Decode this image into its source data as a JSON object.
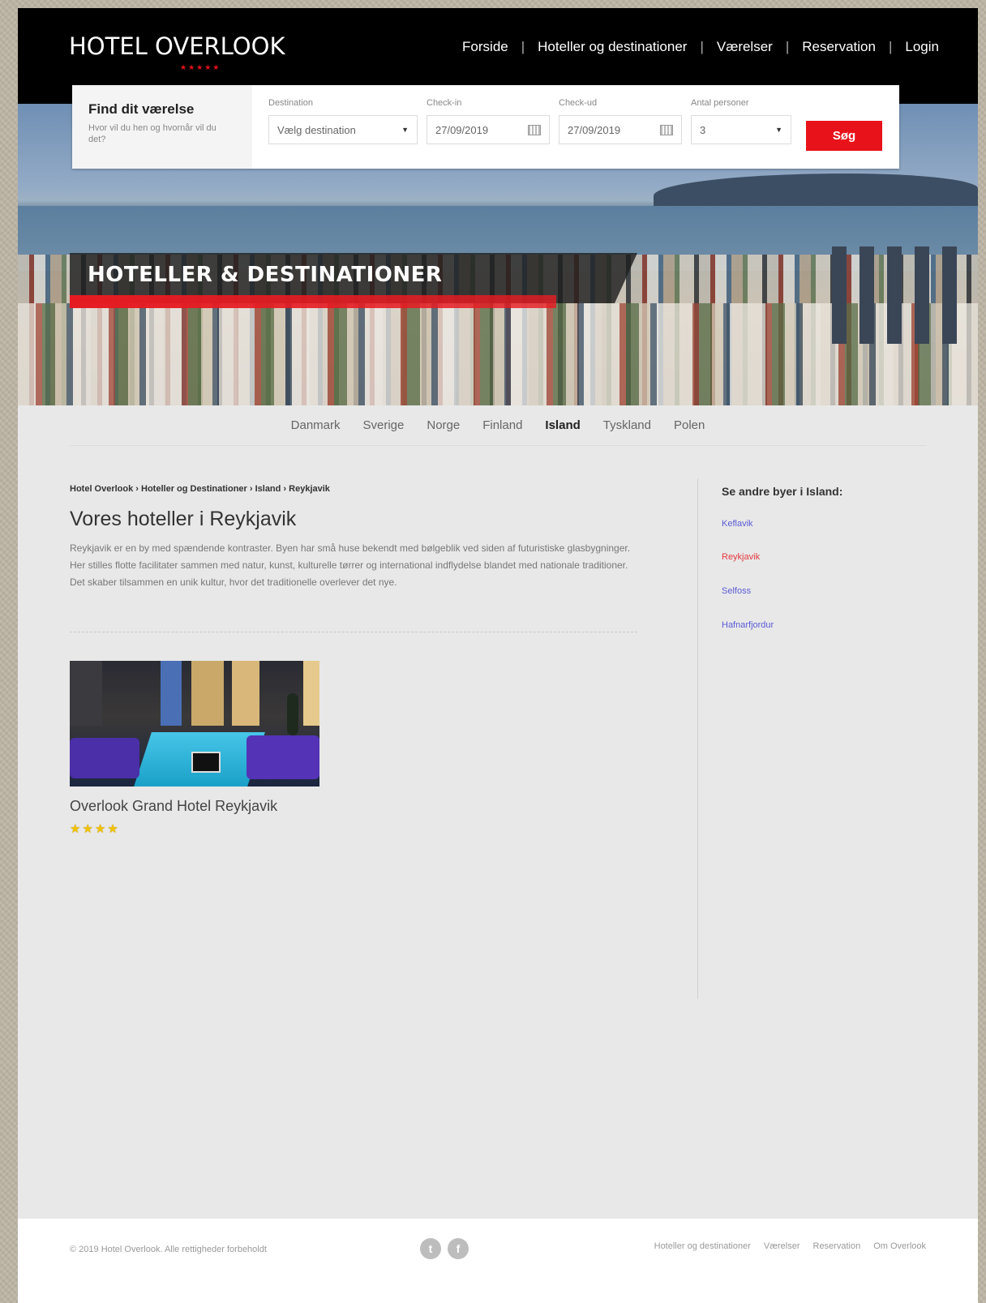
{
  "header": {
    "logo_text": "HOTEL OVERLOOK",
    "logo_stars": "★★★★★",
    "nav": [
      {
        "label": "Forside"
      },
      {
        "label": "Hoteller og destinationer"
      },
      {
        "label": "Værelser"
      },
      {
        "label": "Reservation"
      },
      {
        "label": "Login"
      }
    ],
    "separator": "|"
  },
  "booking": {
    "title": "Find dit værelse",
    "subtitle": "Hvor vil du hen og hvornår vil du det?",
    "destination": {
      "label": "Destination",
      "value": "Vælg destination"
    },
    "checkin": {
      "label": "Check-in",
      "value": "27/09/2019"
    },
    "checkout": {
      "label": "Check-ud",
      "value": "27/09/2019"
    },
    "guests": {
      "label": "Antal personer",
      "value": "3"
    },
    "search_label": "Søg"
  },
  "hero": {
    "title": "HOTELLER & DESTINATIONER"
  },
  "countries": [
    {
      "label": "Danmark",
      "active": false
    },
    {
      "label": "Sverige",
      "active": false
    },
    {
      "label": "Norge",
      "active": false
    },
    {
      "label": "Finland",
      "active": false
    },
    {
      "label": "Island",
      "active": true
    },
    {
      "label": "Tyskland",
      "active": false
    },
    {
      "label": "Polen",
      "active": false
    }
  ],
  "main": {
    "breadcrumb": "Hotel Overlook › Hoteller og Destinationer › Island › Reykjavik",
    "title": "Vores hoteller i Reykjavik",
    "intro": "Reykjavik er en by med spændende kontraster. Byen har små huse bekendt med bølgeblik ved siden af futuristiske glasbygninger. Her stilles flotte facilitater sammen med natur, kunst, kulturelle tørrer og international indflydelse blandet med nationale traditioner. Det skaber tilsammen en unik kultur, hvor det traditionelle overlever det nye.",
    "hotel": {
      "name": "Overlook Grand Hotel Reykjavik",
      "rating": 4,
      "stars_text": "★★★★"
    }
  },
  "sidebar": {
    "title": "Se andre byer i Island:",
    "links": [
      {
        "label": "Keflavik",
        "active": false
      },
      {
        "label": "Reykjavik",
        "active": true
      },
      {
        "label": "Selfoss",
        "active": false
      },
      {
        "label": "Hafnarfjordur",
        "active": false
      }
    ]
  },
  "footer": {
    "copyright": "© 2019 Hotel Overlook. Alle rettigheder forbeholdt",
    "social": [
      {
        "icon": "twitter-icon",
        "glyph": "t"
      },
      {
        "icon": "facebook-icon",
        "glyph": "f"
      }
    ],
    "links": [
      {
        "label": "Hoteller og destinationer"
      },
      {
        "label": "Værelser"
      },
      {
        "label": "Reservation"
      },
      {
        "label": "Om Overlook"
      }
    ]
  }
}
